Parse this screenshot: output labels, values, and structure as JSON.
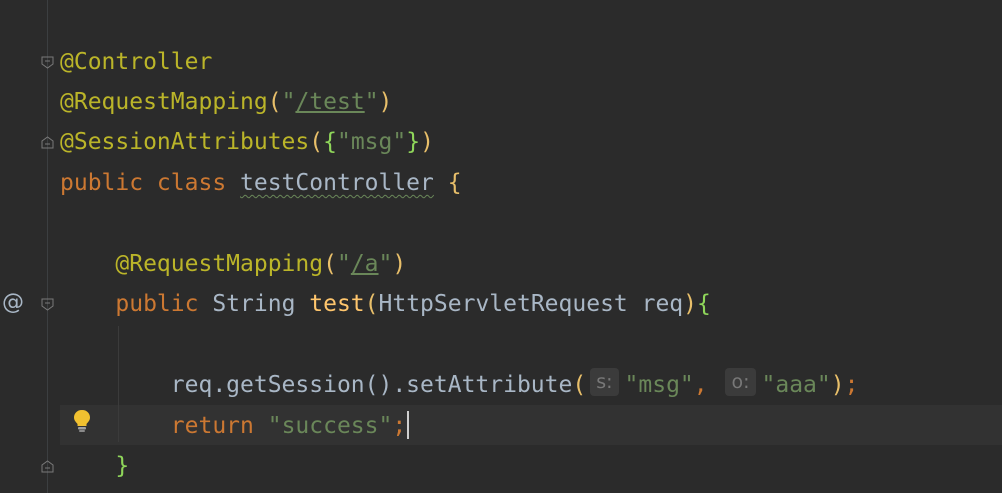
{
  "editor": {
    "lines": [
      {
        "id": "l1",
        "tokens": [
          {
            "cls": "ann",
            "text": "@Controller"
          }
        ]
      },
      {
        "id": "l2",
        "tokens": [
          {
            "cls": "ann",
            "text": "@RequestMapping"
          },
          {
            "cls": "paren-y",
            "text": "("
          },
          {
            "cls": "str",
            "text": "\""
          },
          {
            "cls": "str-link",
            "text": "/test"
          },
          {
            "cls": "str",
            "text": "\""
          },
          {
            "cls": "paren-y",
            "text": ")"
          }
        ]
      },
      {
        "id": "l3",
        "tokens": [
          {
            "cls": "ann",
            "text": "@SessionAttributes"
          },
          {
            "cls": "paren-y",
            "text": "("
          },
          {
            "cls": "brace-g",
            "text": "{"
          },
          {
            "cls": "str",
            "text": "\"msg\""
          },
          {
            "cls": "brace-g",
            "text": "}"
          },
          {
            "cls": "paren-y",
            "text": ")"
          }
        ]
      },
      {
        "id": "l4",
        "tokens": [
          {
            "cls": "kw",
            "text": "public class "
          },
          {
            "cls": "cls-name",
            "text": "testController"
          },
          {
            "cls": "punc",
            "text": " "
          },
          {
            "cls": "paren-y",
            "text": "{"
          }
        ]
      },
      {
        "id": "l6",
        "tokens": [
          {
            "cls": "punc",
            "text": "    "
          },
          {
            "cls": "ann",
            "text": "@RequestMapping"
          },
          {
            "cls": "paren-y",
            "text": "("
          },
          {
            "cls": "str",
            "text": "\""
          },
          {
            "cls": "str-link",
            "text": "/a"
          },
          {
            "cls": "str",
            "text": "\""
          },
          {
            "cls": "paren-y",
            "text": ")"
          }
        ]
      },
      {
        "id": "l7",
        "tokens": [
          {
            "cls": "punc",
            "text": "    "
          },
          {
            "cls": "kw",
            "text": "public "
          },
          {
            "cls": "punc",
            "text": "String "
          },
          {
            "cls": "func",
            "text": "test"
          },
          {
            "cls": "paren-y",
            "text": "("
          },
          {
            "cls": "punc",
            "text": "HttpServletRequest req"
          },
          {
            "cls": "paren-y",
            "text": ")"
          },
          {
            "cls": "brace-g",
            "text": "{"
          }
        ]
      },
      {
        "id": "l9",
        "tokens": [
          {
            "cls": "punc",
            "text": "        req.getSession().setAttribute"
          },
          {
            "cls": "paren-y",
            "text": "("
          },
          {
            "cls": "hint",
            "text": "s:"
          },
          {
            "cls": "str",
            "text": "\"msg\""
          },
          {
            "cls": "kw",
            "text": ", "
          },
          {
            "cls": "hint",
            "text": "o:"
          },
          {
            "cls": "str",
            "text": "\"aaa\""
          },
          {
            "cls": "paren-y",
            "text": ")"
          },
          {
            "cls": "kw",
            "text": ";"
          }
        ]
      },
      {
        "id": "l10",
        "tokens": [
          {
            "cls": "punc",
            "text": "        "
          },
          {
            "cls": "kw",
            "text": "return "
          },
          {
            "cls": "str",
            "text": "\"success\""
          },
          {
            "cls": "kw",
            "text": ";"
          }
        ]
      },
      {
        "id": "l11",
        "tokens": [
          {
            "cls": "punc",
            "text": "    "
          },
          {
            "cls": "brace-g",
            "text": "}"
          }
        ]
      }
    ],
    "gutter": {
      "at_symbol": "@"
    }
  },
  "icons": {
    "fold": "fold-marker-icon",
    "override": "at-implements-icon",
    "intention": "lightbulb-icon"
  },
  "colors": {
    "background": "#2b2b2b",
    "annotation": "#bbb529",
    "keyword": "#cc7832",
    "string": "#6a8759",
    "function": "#ffc66d",
    "text": "#a9b7c6"
  }
}
